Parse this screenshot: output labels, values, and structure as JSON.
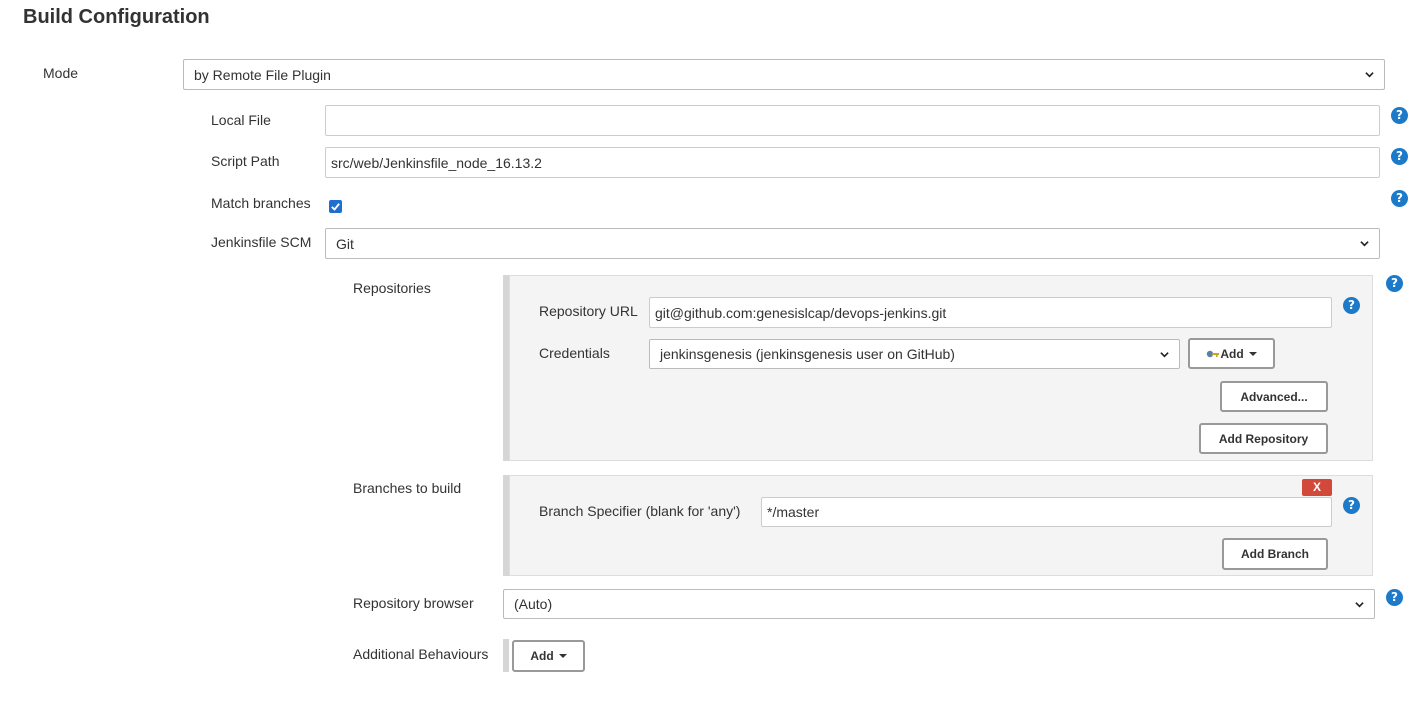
{
  "page": {
    "title": "Build Configuration"
  },
  "mode": {
    "label": "Mode",
    "value": "by Remote File Plugin"
  },
  "local_file": {
    "label": "Local File",
    "value": ""
  },
  "script_path": {
    "label": "Script Path",
    "value": "src/web/Jenkinsfile_node_16.13.2"
  },
  "match_branches": {
    "label": "Match branches",
    "checked": true
  },
  "jenkinsfile_scm": {
    "label": "Jenkinsfile SCM",
    "value": "Git"
  },
  "repositories": {
    "label": "Repositories",
    "url_label": "Repository URL",
    "url_value": "git@github.com:genesislcap/devops-jenkins.git",
    "credentials_label": "Credentials",
    "credentials_value": "jenkinsgenesis (jenkinsgenesis user on GitHub)",
    "add_label": "Add",
    "advanced_label": "Advanced...",
    "add_repository_label": "Add Repository"
  },
  "branches": {
    "label": "Branches to build",
    "delete_label": "X",
    "specifier_label": "Branch Specifier (blank for 'any')",
    "specifier_value": "*/master",
    "add_branch_label": "Add Branch"
  },
  "repository_browser": {
    "label": "Repository browser",
    "value": "(Auto)"
  },
  "additional_behaviours": {
    "label": "Additional Behaviours",
    "add_label": "Add"
  },
  "help": {
    "glyph": "?"
  },
  "colors": {
    "help": "#1d7ac8",
    "delete": "#d24939",
    "checkbox": "#1f6fd1",
    "panel": "#f4f4f4"
  }
}
